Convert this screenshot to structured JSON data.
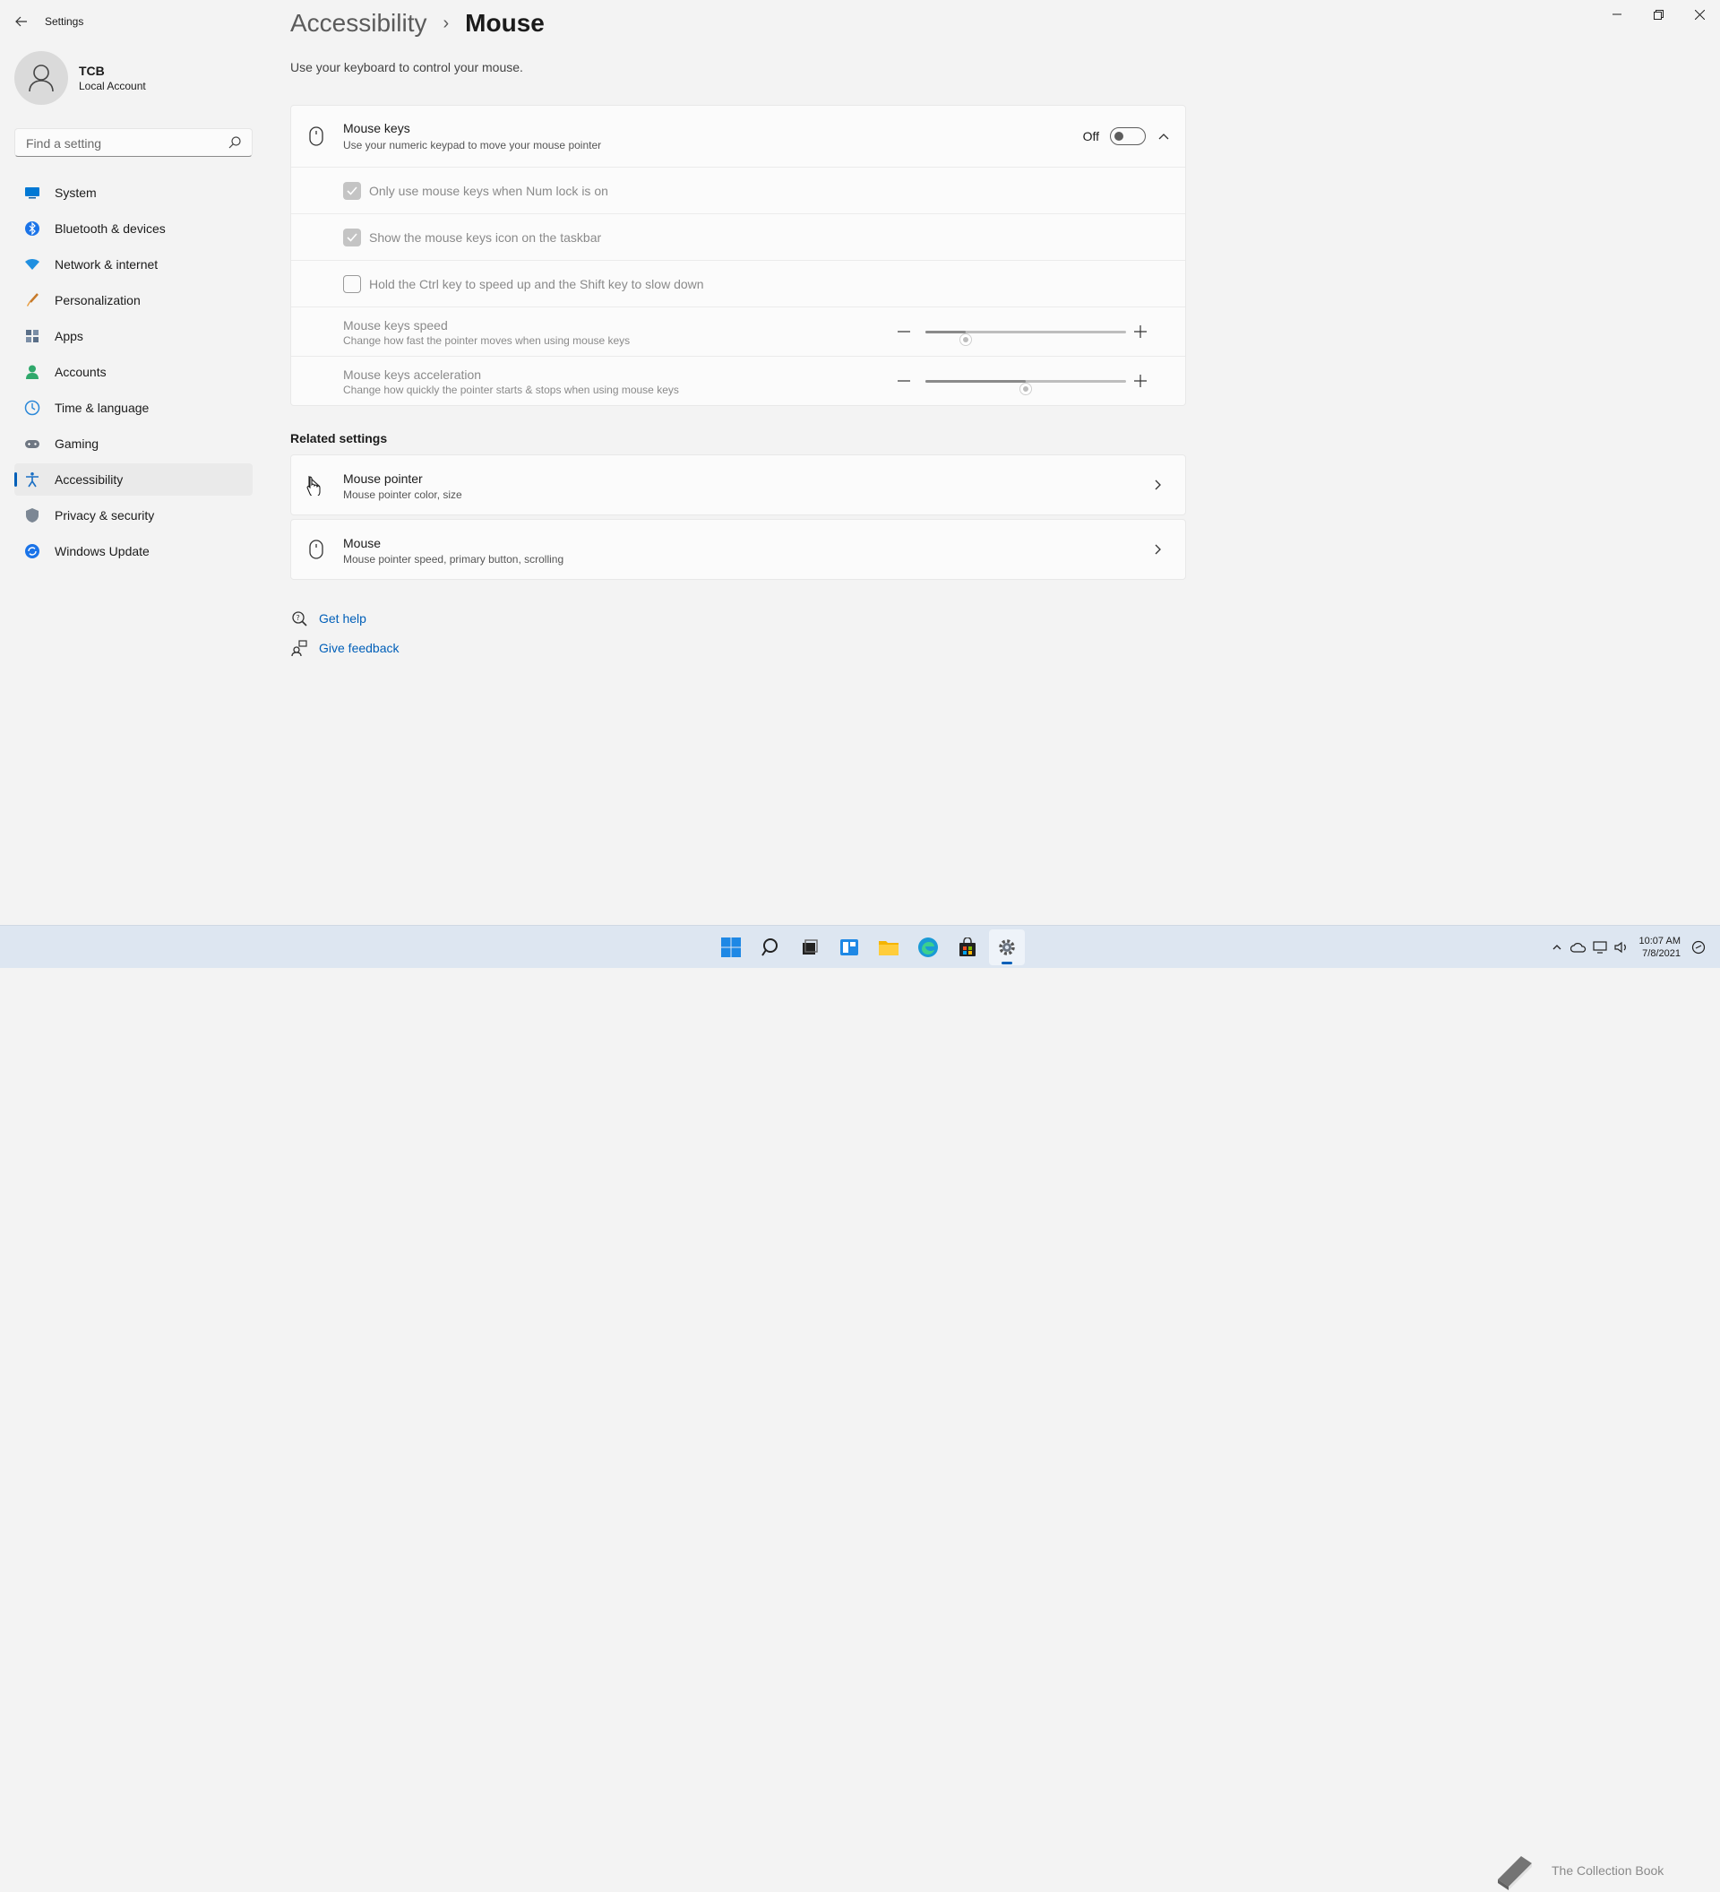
{
  "window": {
    "title": "Settings"
  },
  "user": {
    "name": "TCB",
    "account_type": "Local Account"
  },
  "search": {
    "placeholder": "Find a setting",
    "value": ""
  },
  "sidebar": {
    "items": [
      {
        "label": "System",
        "icon": "system-icon"
      },
      {
        "label": "Bluetooth & devices",
        "icon": "bluetooth-icon"
      },
      {
        "label": "Network & internet",
        "icon": "wifi-icon"
      },
      {
        "label": "Personalization",
        "icon": "brush-icon"
      },
      {
        "label": "Apps",
        "icon": "apps-icon"
      },
      {
        "label": "Accounts",
        "icon": "accounts-icon"
      },
      {
        "label": "Time & language",
        "icon": "globe-clock-icon"
      },
      {
        "label": "Gaming",
        "icon": "gamepad-icon"
      },
      {
        "label": "Accessibility",
        "icon": "accessibility-icon",
        "active": true
      },
      {
        "label": "Privacy & security",
        "icon": "shield-icon"
      },
      {
        "label": "Windows Update",
        "icon": "update-icon"
      }
    ]
  },
  "page": {
    "breadcrumb_parent": "Accessibility",
    "breadcrumb_separator": "›",
    "title": "Mouse",
    "description": "Use your keyboard to control your mouse."
  },
  "mouse_keys": {
    "title": "Mouse keys",
    "subtitle": "Use your numeric keypad to move your mouse pointer",
    "toggle_state": "Off",
    "options": [
      {
        "label": "Only use mouse keys when Num lock is on",
        "checked": true
      },
      {
        "label": "Show the mouse keys icon on the taskbar",
        "checked": true
      },
      {
        "label": "Hold the Ctrl key to speed up and the Shift key to slow down",
        "checked": false
      }
    ],
    "speed": {
      "title": "Mouse keys speed",
      "subtitle": "Change how fast the pointer moves when using mouse keys",
      "value_fraction": 0.2
    },
    "acceleration": {
      "title": "Mouse keys acceleration",
      "subtitle": "Change how quickly the pointer starts & stops when using mouse keys",
      "value_fraction": 0.5
    }
  },
  "related": {
    "heading": "Related settings",
    "items": [
      {
        "title": "Mouse pointer",
        "subtitle": "Mouse pointer color, size",
        "icon": "mouse-pointer-icon"
      },
      {
        "title": "Mouse",
        "subtitle": "Mouse pointer speed, primary button, scrolling",
        "icon": "mouse-icon"
      }
    ]
  },
  "help": {
    "get_help": "Get help",
    "give_feedback": "Give feedback"
  },
  "taskbar": {
    "time": "10:07 AM",
    "date": "7/8/2021",
    "watermark_text": "The Collection Book"
  },
  "colors": {
    "accent": "#005fb8",
    "background": "#f3f3f3",
    "card": "#fbfbfb"
  }
}
